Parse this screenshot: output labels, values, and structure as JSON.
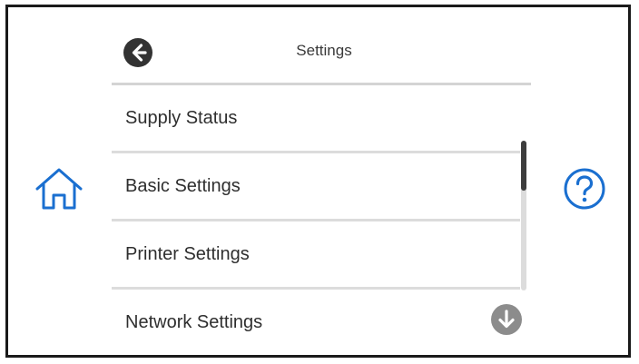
{
  "header": {
    "title": "Settings",
    "back_icon": "arrow-left-circle-icon"
  },
  "menu": {
    "items": [
      {
        "label": "Supply Status"
      },
      {
        "label": "Basic Settings"
      },
      {
        "label": "Printer Settings"
      },
      {
        "label": "Network Settings"
      }
    ]
  },
  "controls": {
    "home_icon": "home-icon",
    "help_icon": "help-icon",
    "scroll_down_icon": "arrow-down-circle-icon"
  },
  "scrollbar": {
    "position_fraction": 0.0
  },
  "colors": {
    "accent_blue": "#1a6fd0",
    "dark_button": "#333333",
    "scroll_button": "#8c8c8c",
    "divider": "#d4d4d4"
  }
}
